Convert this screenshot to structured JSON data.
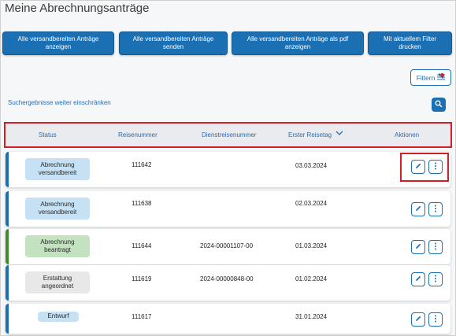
{
  "page": {
    "title": "Meine Abrechnungsanträge"
  },
  "toolbar": {
    "btn1_line1": "Alle versandbereiten Anträge",
    "btn1_line2": "anzeigen",
    "btn2_line1": "Alle versandbereiten Anträge",
    "btn2_line2": "senden",
    "btn3_line1": "Alle versandbereiten Anträge als pdf",
    "btn3_line2": "anzeigen",
    "btn4_line1": "Mit aktuellem Filter",
    "btn4_line2": "drucken",
    "filter_label": "Filtern"
  },
  "search": {
    "refine_label": "Suchergebnisse weiter einschränken",
    "icon": "search-icon"
  },
  "table": {
    "headers": {
      "status": "Status",
      "reisenummer": "Reisenummer",
      "dienstreisenummer": "Dienstreisenummer",
      "erster_reisetag": "Erster Reisetag",
      "aktionen": "Aktionen"
    },
    "sort_icon": "chevron-down-icon",
    "rows": [
      {
        "status_line1": "Abrechnung",
        "status_line2": "versandbereit",
        "reisenummer": "111642",
        "dienstreisenummer": "",
        "erster_reisetag": "03.03.2024"
      },
      {
        "status_line1": "Abrechnung",
        "status_line2": "versandbereit",
        "reisenummer": "111638",
        "dienstreisenummer": "",
        "erster_reisetag": "02.03.2024"
      },
      {
        "status_line1": "Abrechnung",
        "status_line2": "beantragt",
        "reisenummer": "111644",
        "dienstreisenummer": "2024-00001107-00",
        "erster_reisetag": "01.03.2024"
      },
      {
        "status_line1": "Erstattung",
        "status_line2": "angeordnet",
        "reisenummer": "111619",
        "dienstreisenummer": "2024-00000848-00",
        "erster_reisetag": "01.02.2024"
      },
      {
        "status_line1": "Entwurf",
        "status_line2": "",
        "reisenummer": "111617",
        "dienstreisenummer": "",
        "erster_reisetag": "31.01.2024"
      }
    ]
  },
  "colors": {
    "primary": "#1b6fb3",
    "highlight": "#d11f2a",
    "status_blue": "#c6e1f3",
    "status_green": "#c3e3c0",
    "status_gray": "#e8e8e8",
    "accent_green": "#3c8c2c"
  }
}
